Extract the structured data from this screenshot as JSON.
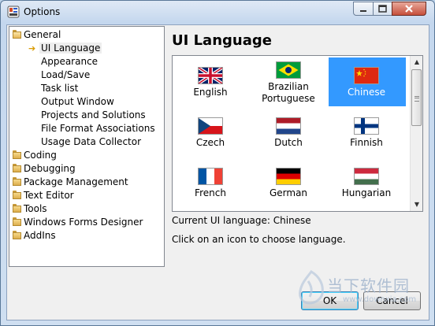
{
  "window": {
    "title": "Options"
  },
  "tree": {
    "items": [
      {
        "label": "General",
        "level": 0,
        "icon": "folder-open-icon",
        "expanded": true
      },
      {
        "label": "UI Language",
        "level": 1,
        "icon": "arrow-right-icon",
        "selected": true
      },
      {
        "label": "Appearance",
        "level": 1
      },
      {
        "label": "Load/Save",
        "level": 1
      },
      {
        "label": "Task list",
        "level": 1
      },
      {
        "label": "Output Window",
        "level": 1
      },
      {
        "label": "Projects and Solutions",
        "level": 1
      },
      {
        "label": "File Format Associations",
        "level": 1
      },
      {
        "label": "Usage Data Collector",
        "level": 1
      },
      {
        "label": "Coding",
        "level": 0,
        "icon": "folder-icon"
      },
      {
        "label": "Debugging",
        "level": 0,
        "icon": "folder-icon"
      },
      {
        "label": "Package Management",
        "level": 0,
        "icon": "folder-icon"
      },
      {
        "label": "Text Editor",
        "level": 0,
        "icon": "folder-icon"
      },
      {
        "label": "Tools",
        "level": 0,
        "icon": "folder-icon"
      },
      {
        "label": "Windows Forms Designer",
        "level": 0,
        "icon": "folder-icon"
      },
      {
        "label": "AddIns",
        "level": 0,
        "icon": "folder-icon"
      }
    ]
  },
  "panel": {
    "heading": "UI Language",
    "languages": [
      {
        "label": "English",
        "flag": "uk-flag-icon"
      },
      {
        "label": "Brazilian Portuguese",
        "flag": "brazil-flag-icon"
      },
      {
        "label": "Chinese",
        "flag": "china-flag-icon",
        "selected": true
      },
      {
        "label": "Czech",
        "flag": "czech-flag-icon"
      },
      {
        "label": "Dutch",
        "flag": "netherlands-flag-icon"
      },
      {
        "label": "Finnish",
        "flag": "finland-flag-icon"
      },
      {
        "label": "French",
        "flag": "france-flag-icon"
      },
      {
        "label": "German",
        "flag": "germany-flag-icon"
      },
      {
        "label": "Hungarian",
        "flag": "hungary-flag-icon"
      }
    ],
    "current_language": "Current UI language: Chinese",
    "hint": "Click on an icon to choose language."
  },
  "buttons": {
    "ok": "OK",
    "cancel": "Cancel"
  },
  "watermark": {
    "text": "当下软件园",
    "url": "www.downxia.com"
  },
  "colors": {
    "selection": "#3399ff",
    "title_gradient_top": "#dfe9f5"
  }
}
